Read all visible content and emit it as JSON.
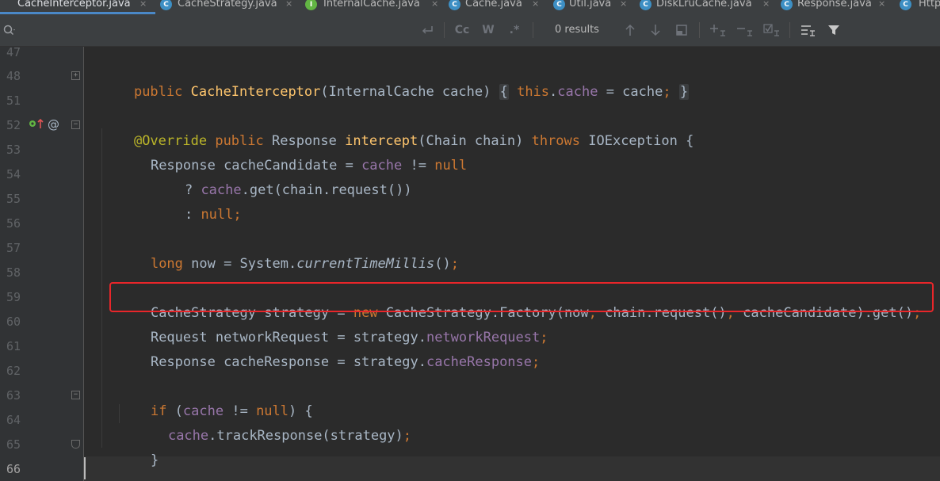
{
  "tabs": [
    {
      "label": "CacheInterceptor.java",
      "icon": "class-icon",
      "icon_letter": "C",
      "active": true
    },
    {
      "label": "CacheStrategy.java",
      "icon": "class-icon",
      "icon_letter": "C",
      "active": false
    },
    {
      "label": "InternalCache.java",
      "icon": "interface-icon",
      "icon_letter": "I",
      "active": false
    },
    {
      "label": "Cache.java",
      "icon": "class-icon",
      "icon_letter": "C",
      "active": false
    },
    {
      "label": "Util.java",
      "icon": "class-icon",
      "icon_letter": "C",
      "active": false
    },
    {
      "label": "DiskLruCache.java",
      "icon": "class-icon",
      "icon_letter": "C",
      "active": false
    },
    {
      "label": "Response.java",
      "icon": "class-icon",
      "icon_letter": "C",
      "active": false
    },
    {
      "label": "Http",
      "icon": "class-icon",
      "icon_letter": "C",
      "active": false
    }
  ],
  "tab_close_glyph": "×",
  "find": {
    "search_icon": "search-icon",
    "match_case_label": "Cc",
    "words_label": "W",
    "regex_label": ".*",
    "results": "0 results"
  },
  "gutter": {
    "line_numbers": [
      "47",
      "48",
      "51",
      "52",
      "53",
      "54",
      "55",
      "56",
      "57",
      "58",
      "59",
      "60",
      "61",
      "62",
      "63",
      "64",
      "65",
      "66"
    ],
    "override_marker_icons": [
      "implement-icon",
      "arrow-up-icon",
      "at-sign-icon"
    ]
  },
  "colors": {
    "background": "#2b2b2b",
    "keyword": "#cc7832",
    "method": "#ffc66d",
    "field": "#9876aa",
    "annotation": "#bbb529",
    "plain": "#a9b7c6",
    "highlight_box": "#e8262a"
  },
  "code": {
    "l48": {
      "kw1": "public",
      "name": "CacheInterceptor",
      "p1": "(InternalCache cache)",
      "b1": "{",
      "kw2": "this",
      "dot": ".",
      "f1": "cache",
      "p2": " = cache",
      "semi": ";",
      "b2": "}"
    },
    "l52": {
      "anno": "@Override",
      "kw1": "public",
      "p1": "Response",
      "name": "intercept",
      "p2": "(Chain chain)",
      "kw2": "throws",
      "p3": "IOException {"
    },
    "l53": {
      "p1": "Response cacheCandidate = ",
      "f1": "cache",
      "p2": " != ",
      "kw1": "null"
    },
    "l54": {
      "p1": "? ",
      "f1": "cache",
      "p2": ".get(chain.request())"
    },
    "l55": {
      "p1": ": ",
      "kw1": "null",
      "semi": ";"
    },
    "l57": {
      "kw1": "long",
      "p1": " now = System.",
      "it1": "currentTimeMillis",
      "p2": "()",
      "semi": ";"
    },
    "l59": {
      "p1": "CacheStrategy strategy = ",
      "kw1": "new",
      "p2": " CacheStrategy.Factory(now",
      "c1": ",",
      "p3": " chain.request()",
      "c2": ",",
      "p4": " cacheCandidate).get()",
      "semi": ";"
    },
    "l60": {
      "p1": "Request networkRequest = strategy.",
      "f1": "networkRequest",
      "semi": ";"
    },
    "l61": {
      "p1": "Response cacheResponse = strategy.",
      "f1": "cacheResponse",
      "semi": ";"
    },
    "l63": {
      "kw1": "if",
      "p1": " (",
      "f1": "cache",
      "p2": " != ",
      "kw2": "null",
      "p3": ") {"
    },
    "l64": {
      "f1": "cache",
      "p1": ".trackResponse(strategy)",
      "semi": ";"
    },
    "l65": {
      "p1": "}"
    }
  }
}
